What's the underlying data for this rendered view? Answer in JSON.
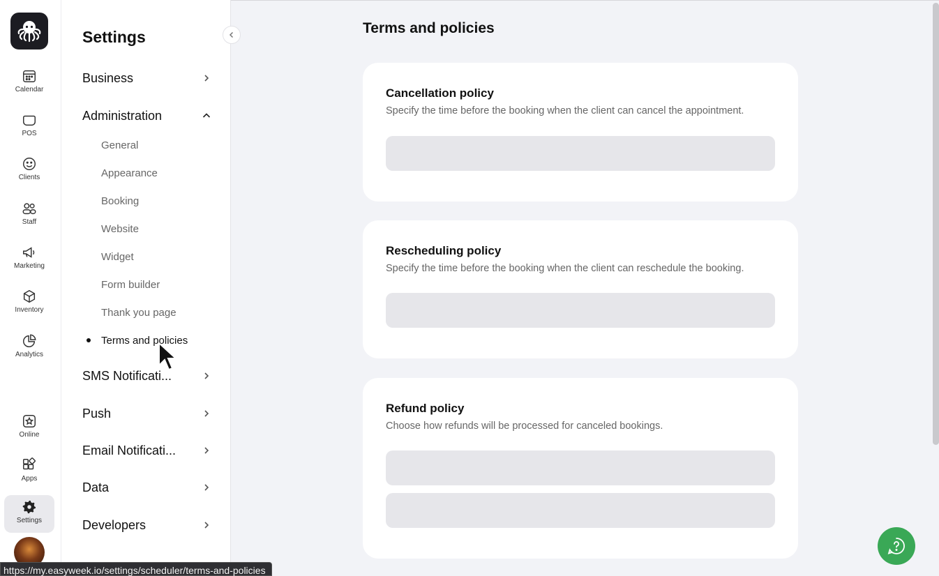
{
  "rail": {
    "items": [
      {
        "label": "Calendar",
        "icon": "calendar-icon"
      },
      {
        "label": "POS",
        "icon": "pos-icon"
      },
      {
        "label": "Clients",
        "icon": "smile-icon"
      },
      {
        "label": "Staff",
        "icon": "staff-icon"
      },
      {
        "label": "Marketing",
        "icon": "megaphone-icon"
      },
      {
        "label": "Inventory",
        "icon": "box-icon"
      },
      {
        "label": "Analytics",
        "icon": "pie-chart-icon"
      },
      {
        "label": "Online",
        "icon": "star-icon"
      },
      {
        "label": "Apps",
        "icon": "apps-icon"
      },
      {
        "label": "Settings",
        "icon": "gear-icon"
      }
    ],
    "active": "Settings"
  },
  "panel": {
    "title": "Settings",
    "sections": [
      {
        "label": "Business",
        "expanded": false
      },
      {
        "label": "Administration",
        "expanded": true
      },
      {
        "label": "SMS Notificati...",
        "expanded": false
      },
      {
        "label": "Push",
        "expanded": false
      },
      {
        "label": "Email Notificati...",
        "expanded": false
      },
      {
        "label": "Data",
        "expanded": false
      },
      {
        "label": "Developers",
        "expanded": false
      }
    ],
    "admin_items": [
      "General",
      "Appearance",
      "Booking",
      "Website",
      "Widget",
      "Form builder",
      "Thank you page",
      "Terms and policies"
    ],
    "active_item": "Terms and policies"
  },
  "main": {
    "title": "Terms and policies",
    "cards": [
      {
        "title": "Cancellation policy",
        "desc": "Specify the time before the booking when the client can cancel the appointment."
      },
      {
        "title": "Rescheduling policy",
        "desc": "Specify the time before the booking when the client can reschedule the booking."
      },
      {
        "title": "Refund policy",
        "desc": "Choose how refunds will be processed for canceled bookings."
      }
    ]
  },
  "status_bar": {
    "url": "https://my.easyweek.io/settings/scheduler/terms-and-policies"
  },
  "colors": {
    "help_button": "#3aa856",
    "active_rail_bg": "#e9e9ed",
    "skeleton": "#e6e6ea"
  }
}
